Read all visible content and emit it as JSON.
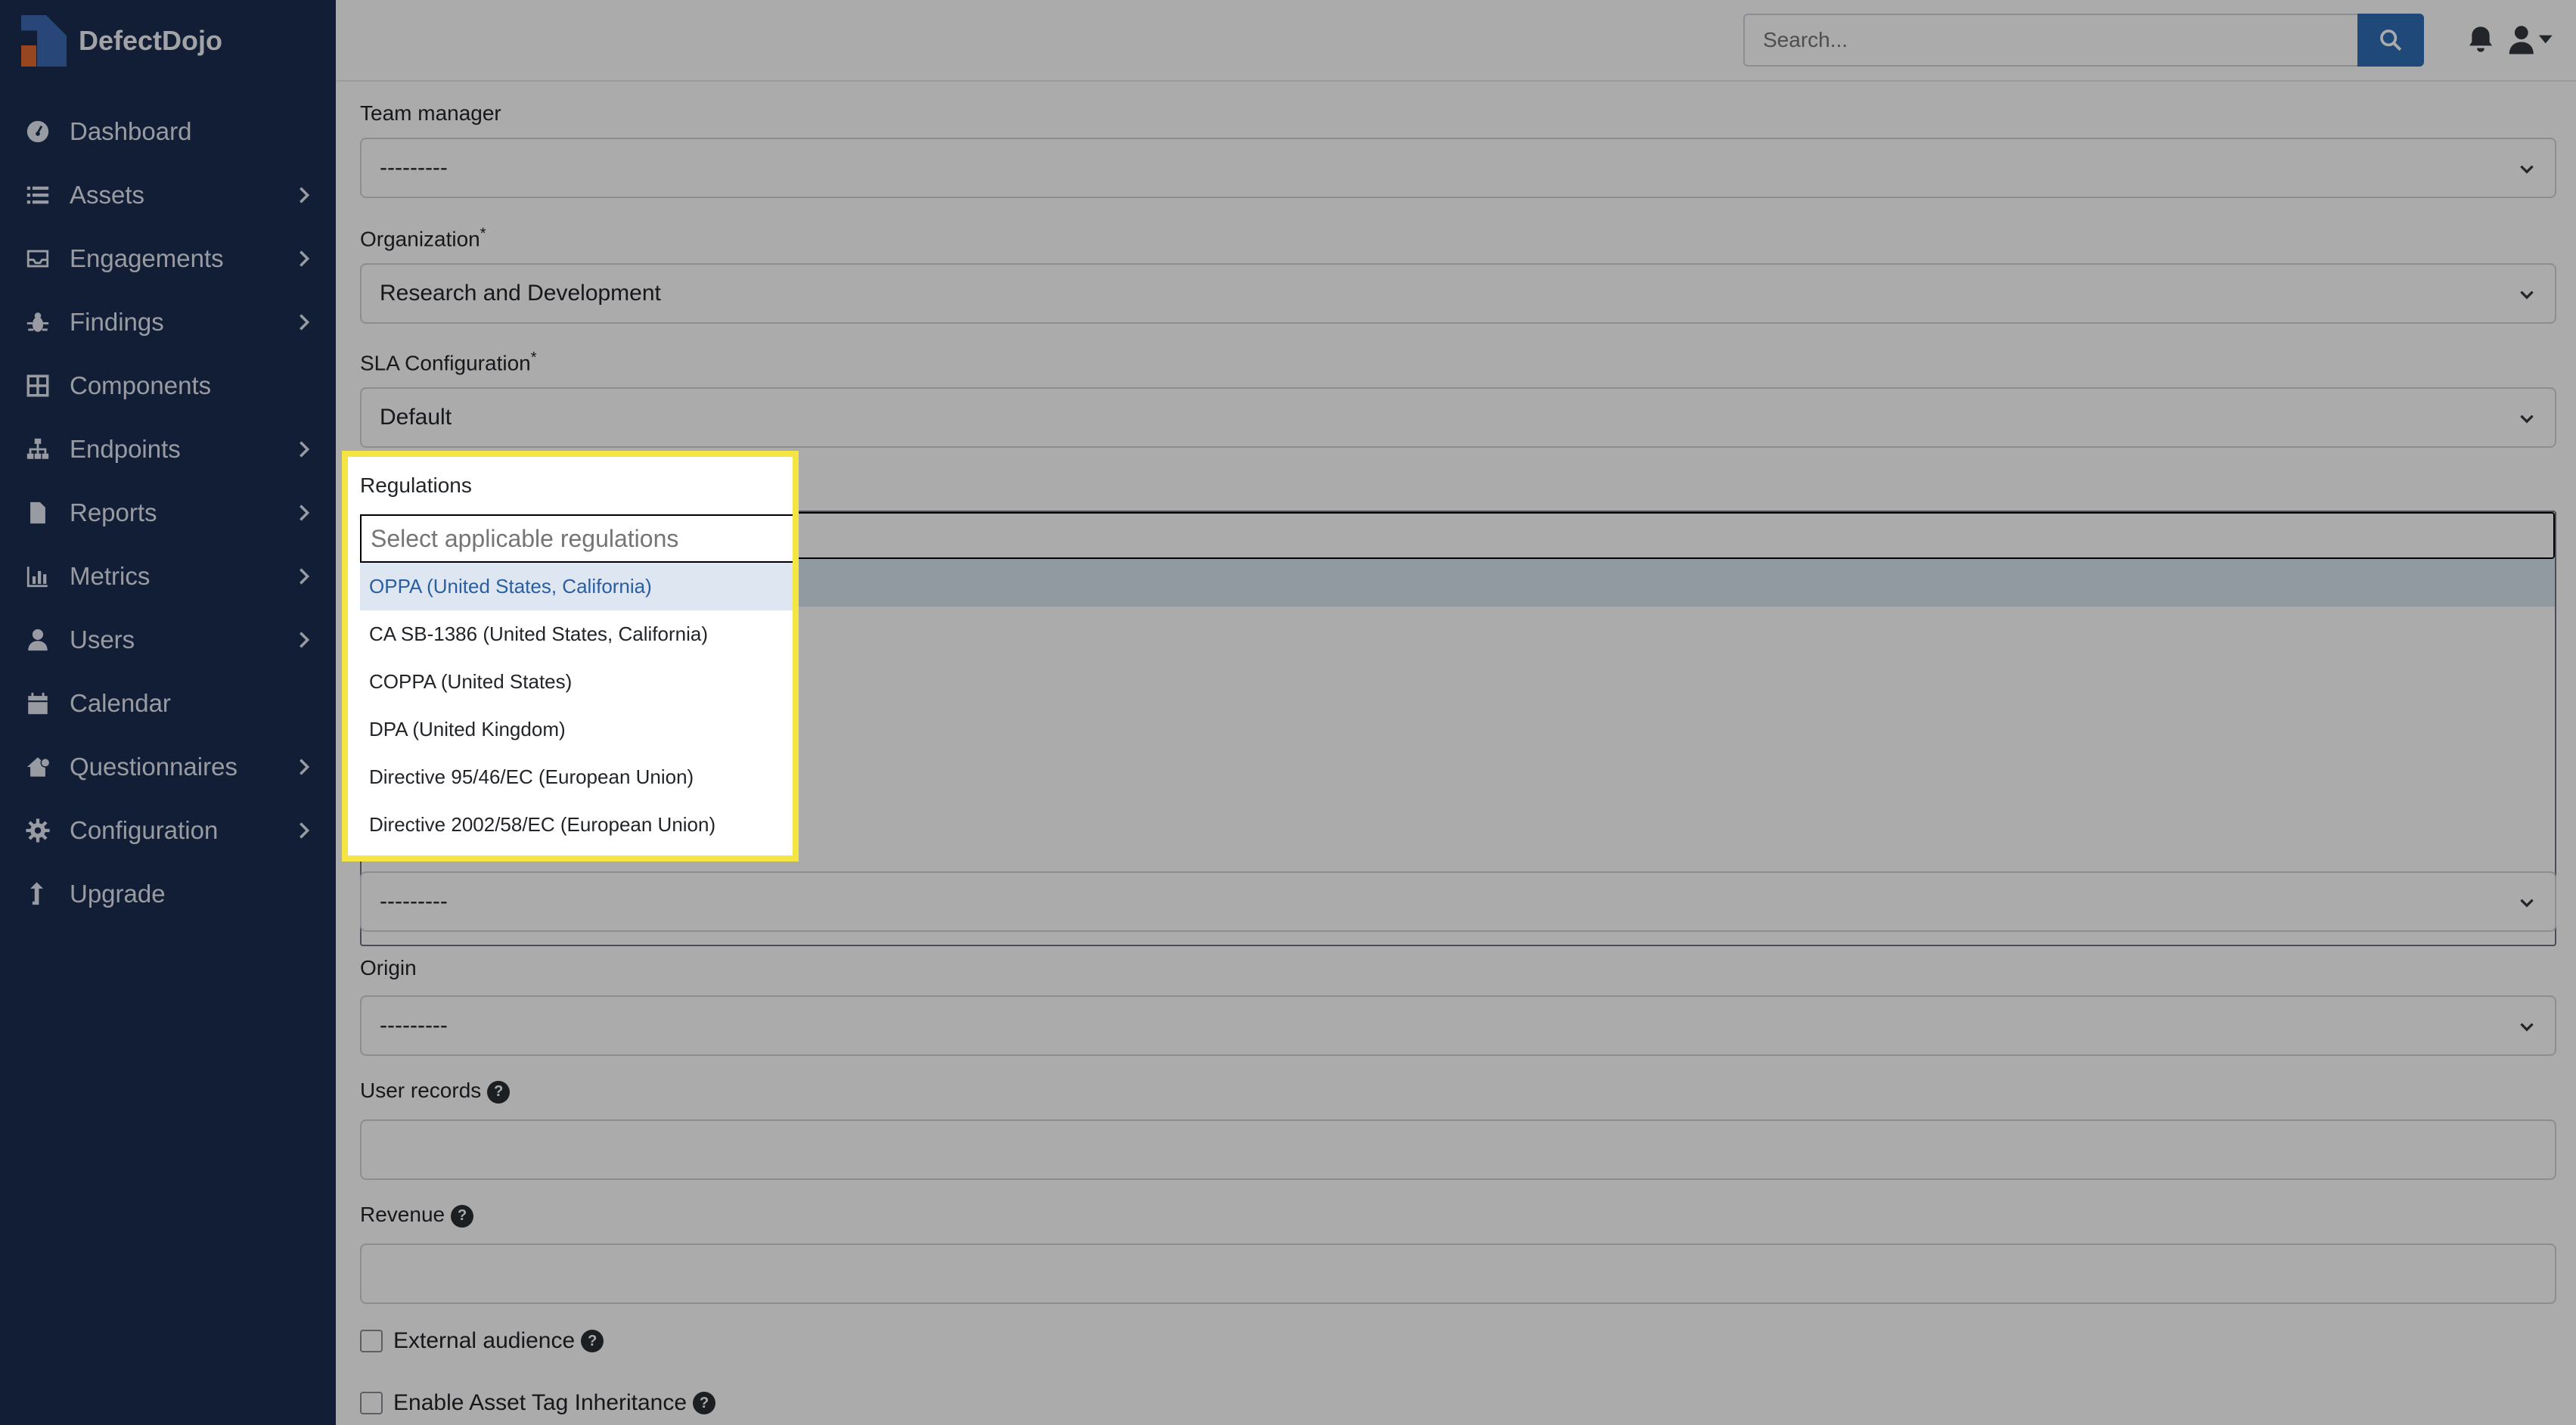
{
  "app": {
    "name": "DefectDojo"
  },
  "sidebar": {
    "items": [
      {
        "label": "Dashboard",
        "icon": "dashboard-icon",
        "has_submenu": false
      },
      {
        "label": "Assets",
        "icon": "list-icon",
        "has_submenu": true
      },
      {
        "label": "Engagements",
        "icon": "inbox-icon",
        "has_submenu": true
      },
      {
        "label": "Findings",
        "icon": "bug-icon",
        "has_submenu": true
      },
      {
        "label": "Components",
        "icon": "table-icon",
        "has_submenu": false
      },
      {
        "label": "Endpoints",
        "icon": "sitemap-icon",
        "has_submenu": true
      },
      {
        "label": "Reports",
        "icon": "file-icon",
        "has_submenu": true
      },
      {
        "label": "Metrics",
        "icon": "bar-chart-icon",
        "has_submenu": true
      },
      {
        "label": "Users",
        "icon": "user-icon",
        "has_submenu": true
      },
      {
        "label": "Calendar",
        "icon": "calendar-icon",
        "has_submenu": false
      },
      {
        "label": "Questionnaires",
        "icon": "house-question-icon",
        "has_submenu": true
      },
      {
        "label": "Configuration",
        "icon": "gear-icon",
        "has_submenu": true
      },
      {
        "label": "Upgrade",
        "icon": "upgrade-arrow-icon",
        "has_submenu": false
      }
    ]
  },
  "topbar": {
    "search_placeholder": "Search...",
    "search_icon": "search-icon",
    "bell_icon": "bell-icon",
    "user_icon": "user-dropdown-icon"
  },
  "form": {
    "team_manager": {
      "label": "Team manager",
      "value": "---------"
    },
    "organization": {
      "label": "Organization",
      "required": "*",
      "value": "Research and Development"
    },
    "sla": {
      "label": "SLA Configuration",
      "required": "*",
      "value": "Default"
    },
    "regulations": {
      "label": "Regulations",
      "placeholder": "Select applicable regulations",
      "options": [
        "OPPA (United States, California)",
        "CA SB-1386 (United States, California)",
        "COPPA (United States)",
        "DPA (United Kingdom)",
        "Directive 95/46/EC (European Union)",
        "Directive 2002/58/EC (European Union)"
      ],
      "highlighted_index": 0
    },
    "hidden_select": {
      "value": "---------"
    },
    "origin": {
      "label": "Origin",
      "value": "---------"
    },
    "user_records": {
      "label": "User records",
      "help": "?"
    },
    "revenue": {
      "label": "Revenue",
      "help": "?"
    },
    "external_audience": {
      "label": "External audience",
      "help": "?",
      "checked": false
    },
    "tag_inheritance": {
      "label": "Enable Asset Tag Inheritance",
      "help": "?",
      "checked": false
    }
  },
  "colors": {
    "sidebar_bg": "#1b2d4f",
    "accent": "#2f6db5",
    "highlight_border": "#f4e542"
  }
}
